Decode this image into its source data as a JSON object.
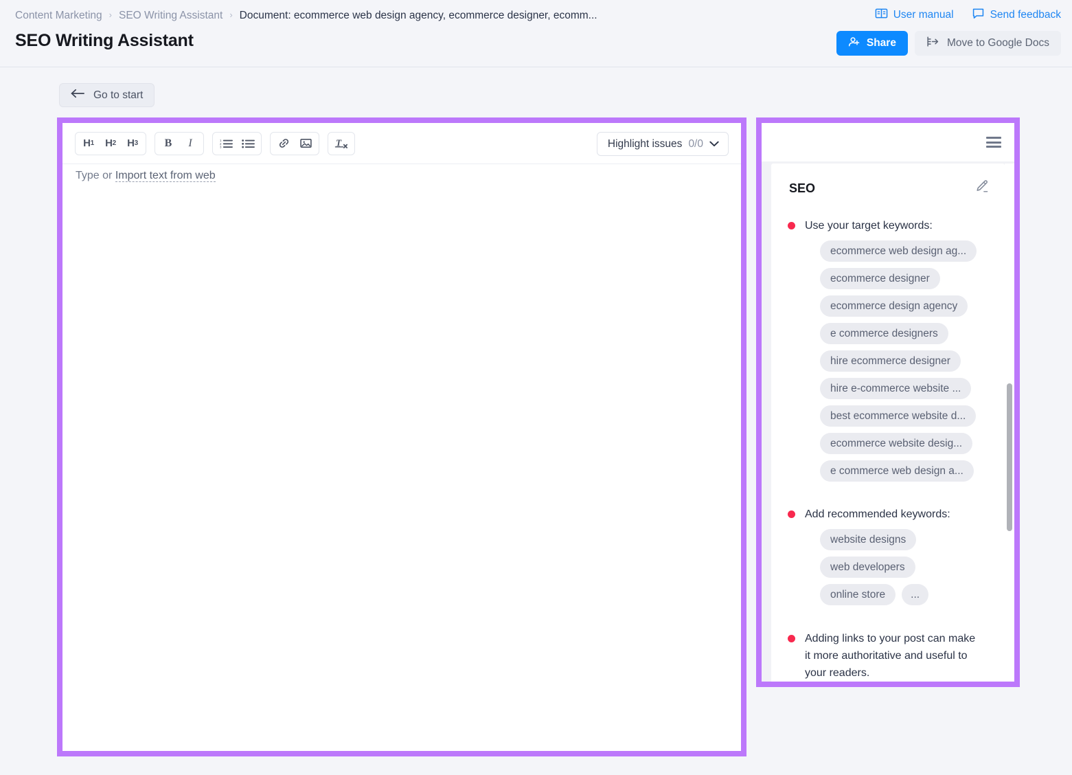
{
  "header": {
    "breadcrumb": [
      {
        "label": "Content Marketing",
        "current": false
      },
      {
        "label": "SEO Writing Assistant",
        "current": false
      },
      {
        "label": "Document: ecommerce web design agency, ecommerce designer, ecomm...",
        "current": true
      }
    ],
    "separator": "›",
    "page_title": "SEO Writing Assistant",
    "links": [
      {
        "label": "User manual",
        "icon": "book-icon"
      },
      {
        "label": "Send feedback",
        "icon": "comment-icon"
      }
    ],
    "share_label": "Share",
    "move_to_google_docs_label": "Move to Google Docs"
  },
  "subheader": {
    "go_to_start_label": "Go to start",
    "back_arrow": "←"
  },
  "editor": {
    "toolbar_groups": [
      {
        "name": "headings",
        "buttons": [
          {
            "name": "heading-1-button",
            "label": "H",
            "sub": "1"
          },
          {
            "name": "heading-2-button",
            "label": "H",
            "sub": "2"
          },
          {
            "name": "heading-3-button",
            "label": "H",
            "sub": "3"
          }
        ]
      },
      {
        "name": "text-style",
        "buttons": [
          {
            "name": "bold-button",
            "label": "B"
          },
          {
            "name": "italic-button",
            "label": "I"
          }
        ]
      },
      {
        "name": "lists",
        "buttons": [
          {
            "name": "ordered-list-button",
            "label": ""
          },
          {
            "name": "bullet-list-button",
            "label": ""
          }
        ]
      },
      {
        "name": "insert",
        "buttons": [
          {
            "name": "insert-link-button",
            "label": ""
          },
          {
            "name": "insert-image-button",
            "label": ""
          }
        ]
      },
      {
        "name": "clear",
        "buttons": [
          {
            "name": "clear-formatting-button",
            "label": ""
          }
        ]
      }
    ],
    "highlight_issues": {
      "label": "Highlight issues",
      "count": "0/0",
      "chevron": "⌄"
    },
    "placeholder_prefix": "Type or ",
    "placeholder_link": "Import text from web"
  },
  "panel": {
    "menu_icon": "hamburger-icon",
    "card_title": "SEO",
    "edit_icon": "pencil-icon",
    "tips": [
      {
        "text": "Use your target keywords:",
        "chips": [
          "ecommerce web design ag...",
          "ecommerce designer",
          "ecommerce design agency",
          "e commerce designers",
          "hire ecommerce designer",
          "hire e-commerce website ...",
          "best ecommerce website d...",
          "ecommerce website desig...",
          "e commerce web design a..."
        ]
      },
      {
        "text": "Add recommended keywords:",
        "chips": [
          "website designs",
          "web developers",
          "online store",
          "..."
        ]
      },
      {
        "text": "Adding links to your post can make it more authoritative and useful to your readers.",
        "chips": []
      }
    ]
  },
  "colors": {
    "accent_blue": "#0d8aff",
    "highlight_purple": "#bc78fb",
    "bullet_red": "#f8294e",
    "background": "#f4f5f9"
  }
}
